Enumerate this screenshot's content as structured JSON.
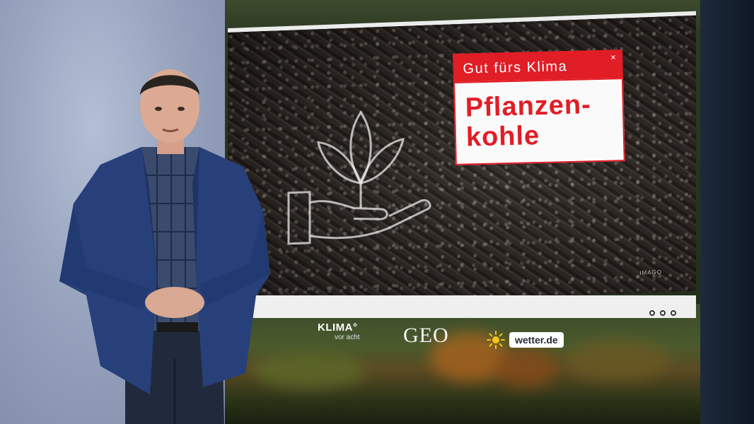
{
  "topic": {
    "kicker": "Gut fürs Klima",
    "title_line1": "Pflanzen-",
    "title_line2": "kohle",
    "close_symbol": "×"
  },
  "photo_credit": "IMAGO",
  "logos": {
    "klima_main": "KLIMA°",
    "klima_sub": "vor acht",
    "geo": "GEO",
    "wetter": "wetter.de"
  },
  "colors": {
    "accent_red": "#e11d26",
    "slide_frame": "#efefef",
    "jacket_blue": "#27407a"
  },
  "icons": [
    "plant-hand-icon",
    "sun-icon",
    "close-icon",
    "page-dots-icon"
  ]
}
